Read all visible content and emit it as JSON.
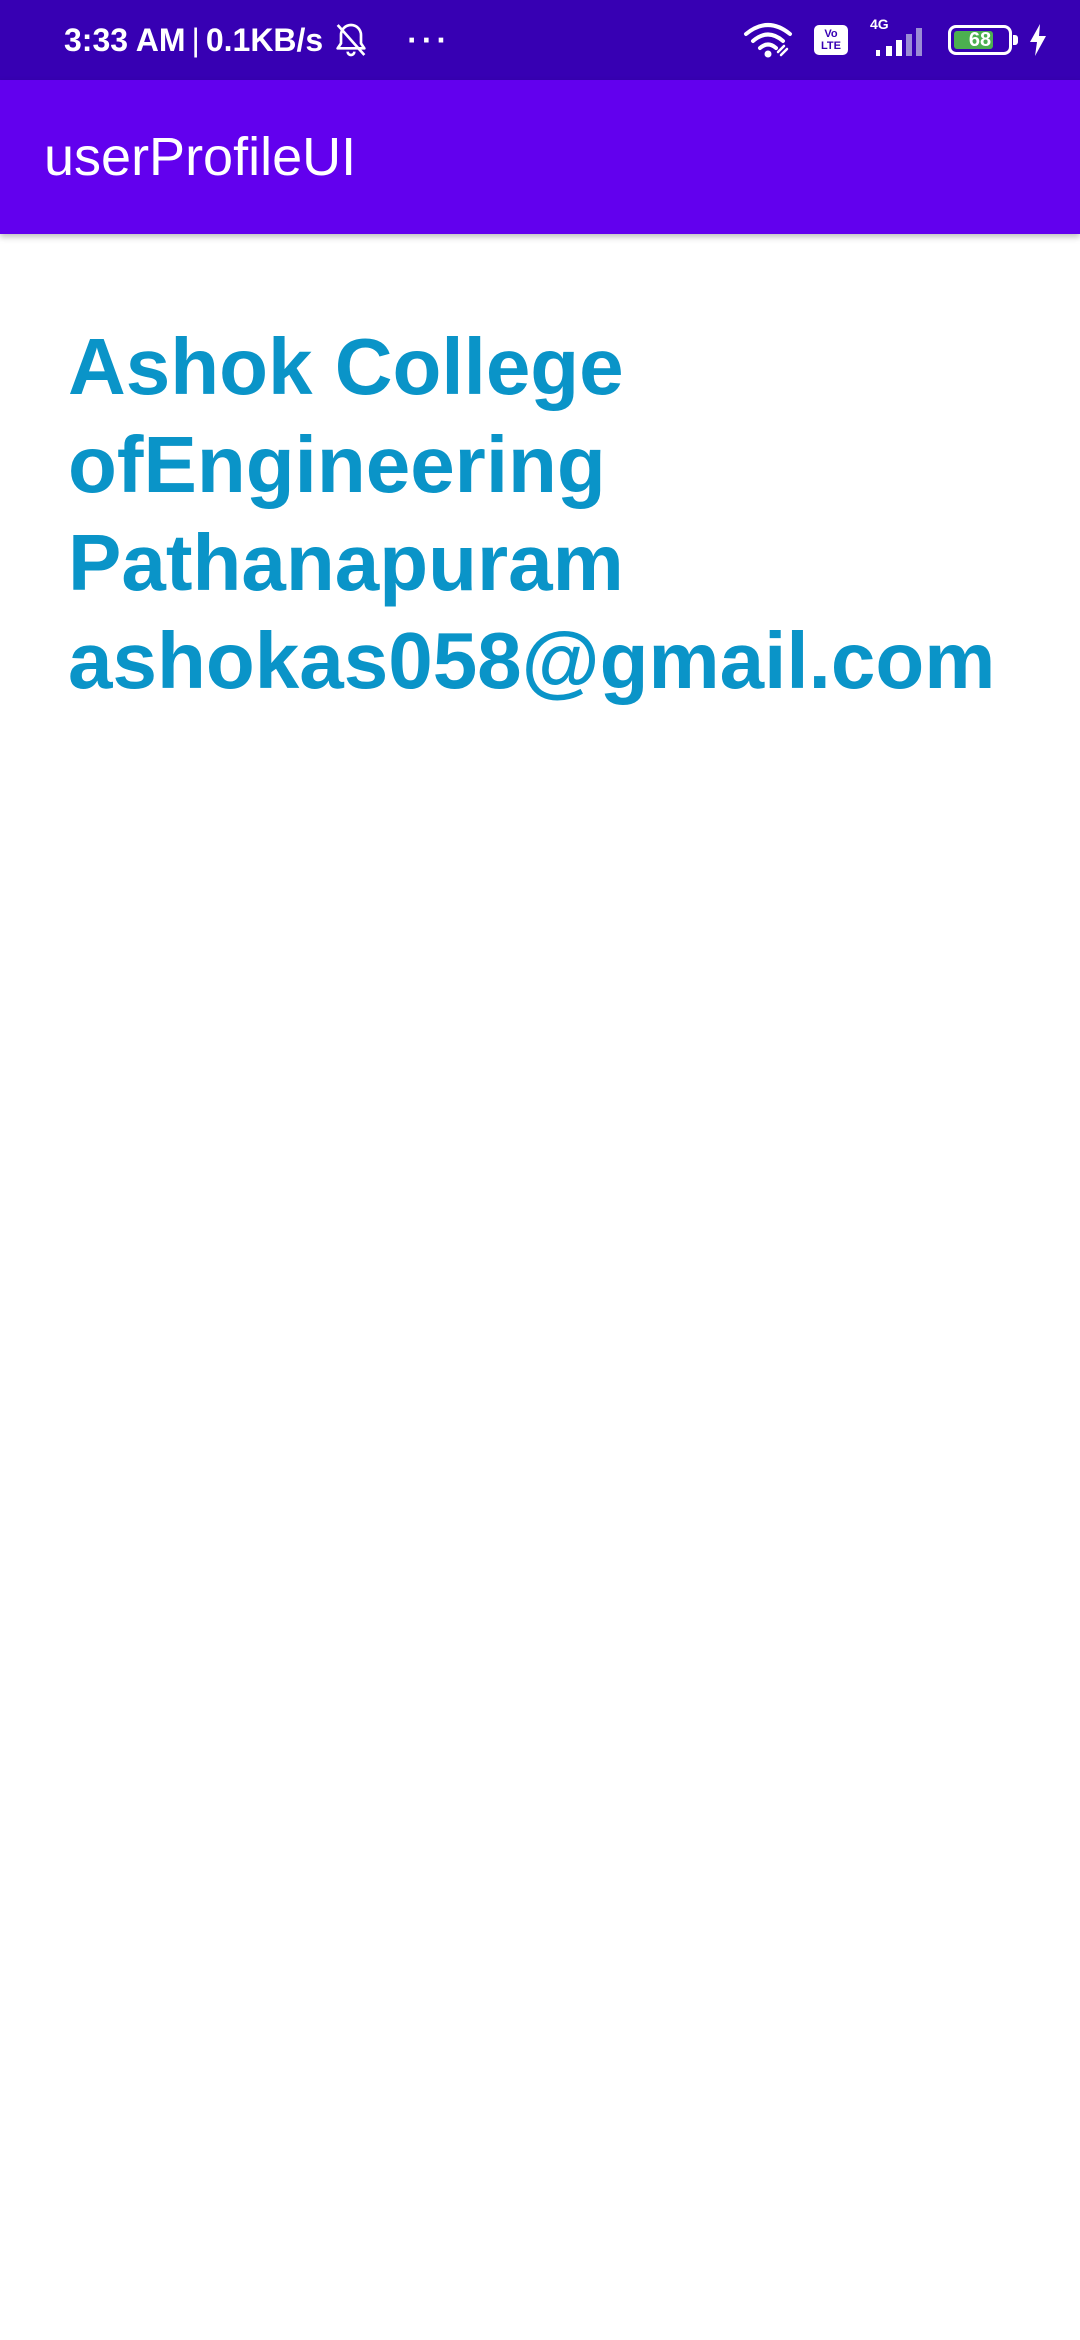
{
  "status_bar": {
    "time": "3:33 AM",
    "separator": "|",
    "speed": "0.1KB/s",
    "more_dots": "···",
    "volte_top": "Vo",
    "volte_bottom": "LTE",
    "network_type": "4G",
    "battery_level": "68",
    "icons": [
      "bell-off-icon",
      "wifi-icon",
      "volte-icon",
      "signal-icon",
      "battery-icon",
      "charging-icon"
    ]
  },
  "app_bar": {
    "title": "userProfileUI"
  },
  "profile": {
    "line1": "Ashok College",
    "line2": "ofEngineering",
    "line3": "Pathanapuram",
    "email": "ashokas058@gmail.com"
  },
  "colors": {
    "status_bar": "#3700B3",
    "app_bar": "#6200EE",
    "text_accent": "#0A94C8",
    "battery_fill": "#4CAF50"
  }
}
